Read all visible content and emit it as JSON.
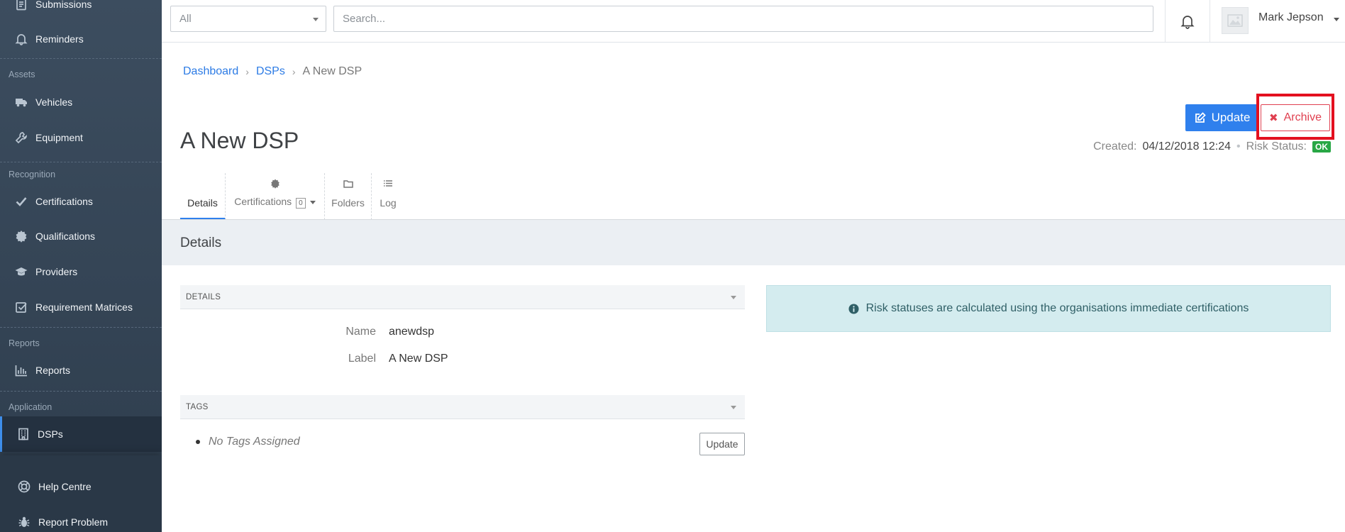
{
  "sidebar": {
    "items_top": [
      {
        "label": "Submissions",
        "icon": "document-icon"
      },
      {
        "label": "Reminders",
        "icon": "bell-icon"
      }
    ],
    "sections": {
      "assets": "Assets",
      "recognition": "Recognition",
      "reports": "Reports",
      "application": "Application"
    },
    "assets": [
      {
        "label": "Vehicles",
        "icon": "truck-icon"
      },
      {
        "label": "Equipment",
        "icon": "wrench-icon"
      }
    ],
    "recognition": [
      {
        "label": "Certifications",
        "icon": "check-icon"
      },
      {
        "label": "Qualifications",
        "icon": "certificate-icon"
      },
      {
        "label": "Providers",
        "icon": "graduation-cap-icon"
      },
      {
        "label": "Requirement Matrices",
        "icon": "checkbox-icon"
      }
    ],
    "reports": [
      {
        "label": "Reports",
        "icon": "bar-chart-icon"
      }
    ],
    "application": [
      {
        "label": "DSPs",
        "icon": "building-icon"
      }
    ],
    "bottom": [
      {
        "label": "Help Centre",
        "icon": "lifebuoy-icon"
      },
      {
        "label": "Report Problem",
        "icon": "bug-icon"
      }
    ]
  },
  "topbar": {
    "filter_value": "All",
    "search_placeholder": "Search...",
    "user_name": "Mark Jepson"
  },
  "breadcrumb": {
    "items": [
      "Dashboard",
      "DSPs"
    ],
    "current": "A New DSP"
  },
  "page": {
    "title": "A New DSP",
    "update_label": "Update",
    "archive_label": "Archive",
    "created_label": "Created:",
    "created_value": "04/12/2018 12:24",
    "risk_label": "Risk Status:",
    "risk_value": "OK"
  },
  "tabs": [
    {
      "label": "Details"
    },
    {
      "label": "Certifications",
      "count": "0"
    },
    {
      "label": "Folders"
    },
    {
      "label": "Log"
    }
  ],
  "details": {
    "band_title": "Details",
    "panel_title": "DETAILS",
    "fields": [
      {
        "label": "Name",
        "value": "anewdsp"
      },
      {
        "label": "Label",
        "value": "A New DSP"
      }
    ],
    "tags_title": "TAGS",
    "tags_empty": "No Tags Assigned",
    "tags_update_label": "Update",
    "info_text": "Risk statuses are calculated using the organisations immediate certifications"
  },
  "colors": {
    "accent": "#2f80ed",
    "danger": "#e04050",
    "highlight": "#e3101f",
    "ok": "#28a745"
  }
}
